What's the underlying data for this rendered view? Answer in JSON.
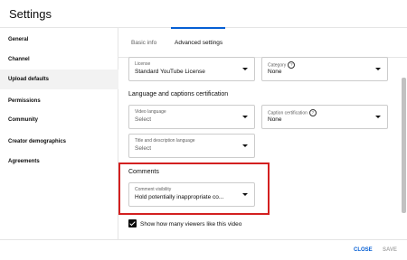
{
  "header": {
    "title": "Settings"
  },
  "sidebar": {
    "items": [
      {
        "label": "General"
      },
      {
        "label": "Channel"
      },
      {
        "label": "Upload defaults"
      },
      {
        "label": "Permissions"
      },
      {
        "label": "Community"
      },
      {
        "label": "Creator demographics"
      },
      {
        "label": "Agreements"
      }
    ],
    "active_index": 2
  },
  "tabs": [
    {
      "label": "Basic info"
    },
    {
      "label": "Advanced settings"
    }
  ],
  "fields": {
    "license": {
      "label": "License",
      "value": "Standard YouTube License"
    },
    "category": {
      "label": "Category",
      "value": "None"
    },
    "video_language": {
      "label": "Video language",
      "value": "Select"
    },
    "caption_certification": {
      "label": "Caption certification",
      "value": "None"
    },
    "title_description_language": {
      "label": "Title and description language",
      "value": "Select"
    },
    "comment_visibility": {
      "label": "Comment visibility",
      "value": "Hold potentially inappropriate co..."
    }
  },
  "sections": {
    "language_captions": "Language and captions certification",
    "comments": "Comments"
  },
  "checkbox": {
    "label": "Show how many viewers like this video",
    "checked": true
  },
  "footer": {
    "close_label": "CLOSE",
    "save_label": "SAVE"
  },
  "colors": {
    "accent": "#065fd4",
    "highlight": "#d32020"
  }
}
